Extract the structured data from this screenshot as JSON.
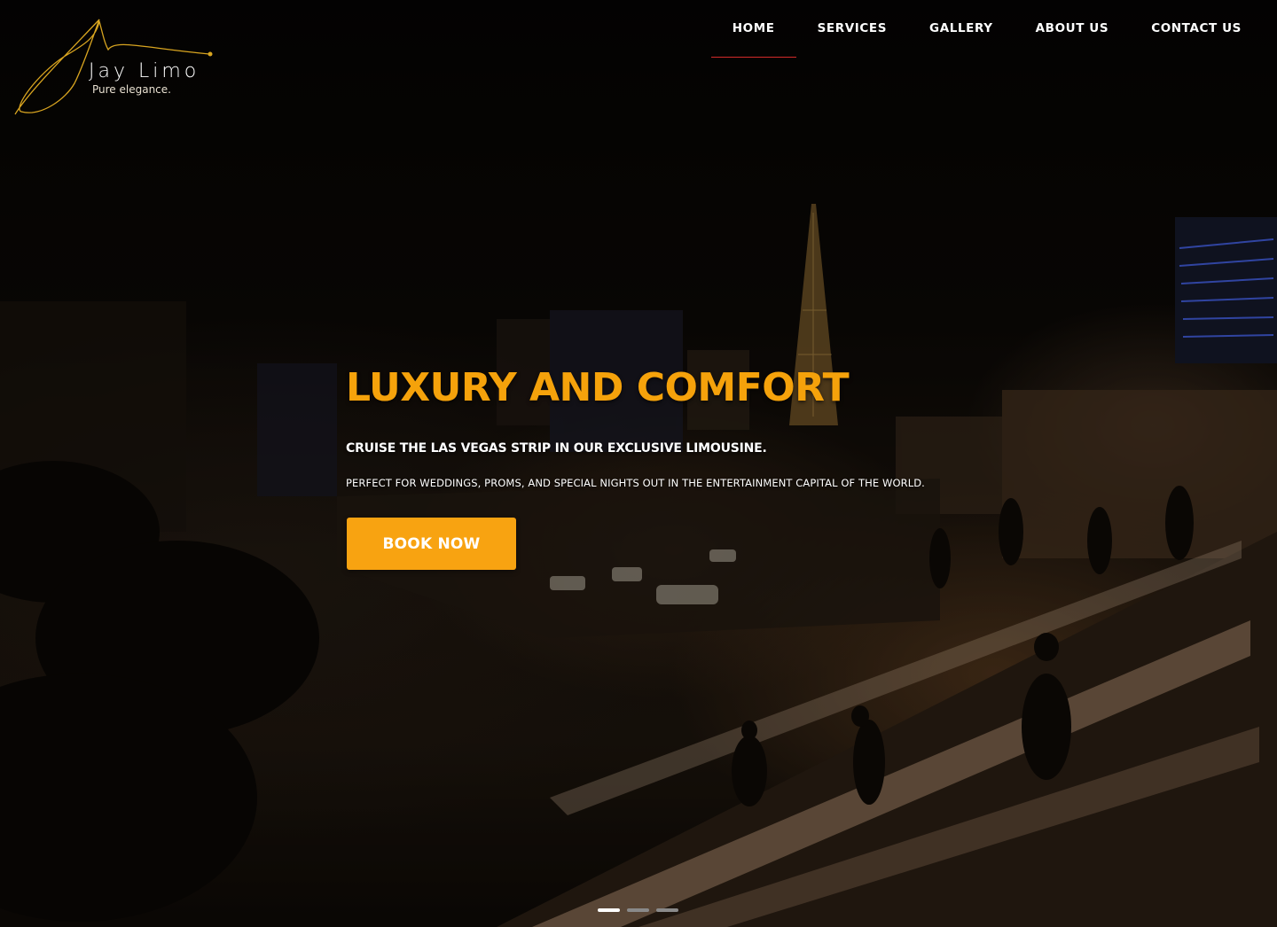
{
  "brand": {
    "name": "Jay Limo",
    "tagline": "Pure elegance."
  },
  "nav": {
    "items": [
      {
        "label": "HOME",
        "active": true
      },
      {
        "label": "SERVICES",
        "active": false
      },
      {
        "label": "GALLERY",
        "active": false
      },
      {
        "label": "ABOUT US",
        "active": false
      },
      {
        "label": "CONTACT US",
        "active": false
      }
    ]
  },
  "hero": {
    "headline": "LUXURY AND COMFORT",
    "subhead": "CRUISE THE LAS VEGAS STRIP IN OUR EXCLUSIVE LIMOUSINE.",
    "description": "PERFECT FOR WEDDINGS, PROMS, AND SPECIAL NIGHTS OUT IN THE ENTERTAINMENT CAPITAL OF THE WORLD.",
    "cta_label": "BOOK NOW"
  },
  "slider": {
    "count": 3,
    "active_index": 0
  },
  "colors": {
    "accent": "#f5a20b",
    "button": "#f8a311",
    "nav_underline": "#d42a2a",
    "logo_gold": "#d9a520"
  }
}
